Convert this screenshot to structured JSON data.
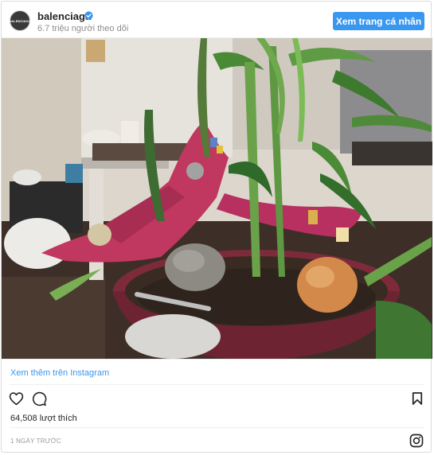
{
  "account": {
    "avatar_text": "BALENCIAGA",
    "username": "balenciaga",
    "followers": "6.7 triệu người theo dõi",
    "view_profile_label": "Xem trang cá nhân"
  },
  "post": {
    "more_link": "Xem thêm trên Instagram",
    "likes": "64,508 lượt thích",
    "timestamp": "1 NGÀY TRƯỚC"
  },
  "icons": {
    "verified": "verified-badge-icon",
    "like": "heart-icon",
    "comment": "comment-icon",
    "save": "bookmark-icon",
    "instagram": "instagram-logo-icon"
  },
  "colors": {
    "accent": "#3897f0",
    "text": "#262626",
    "muted": "#8e8e8e",
    "border": "#dbdbdb"
  }
}
